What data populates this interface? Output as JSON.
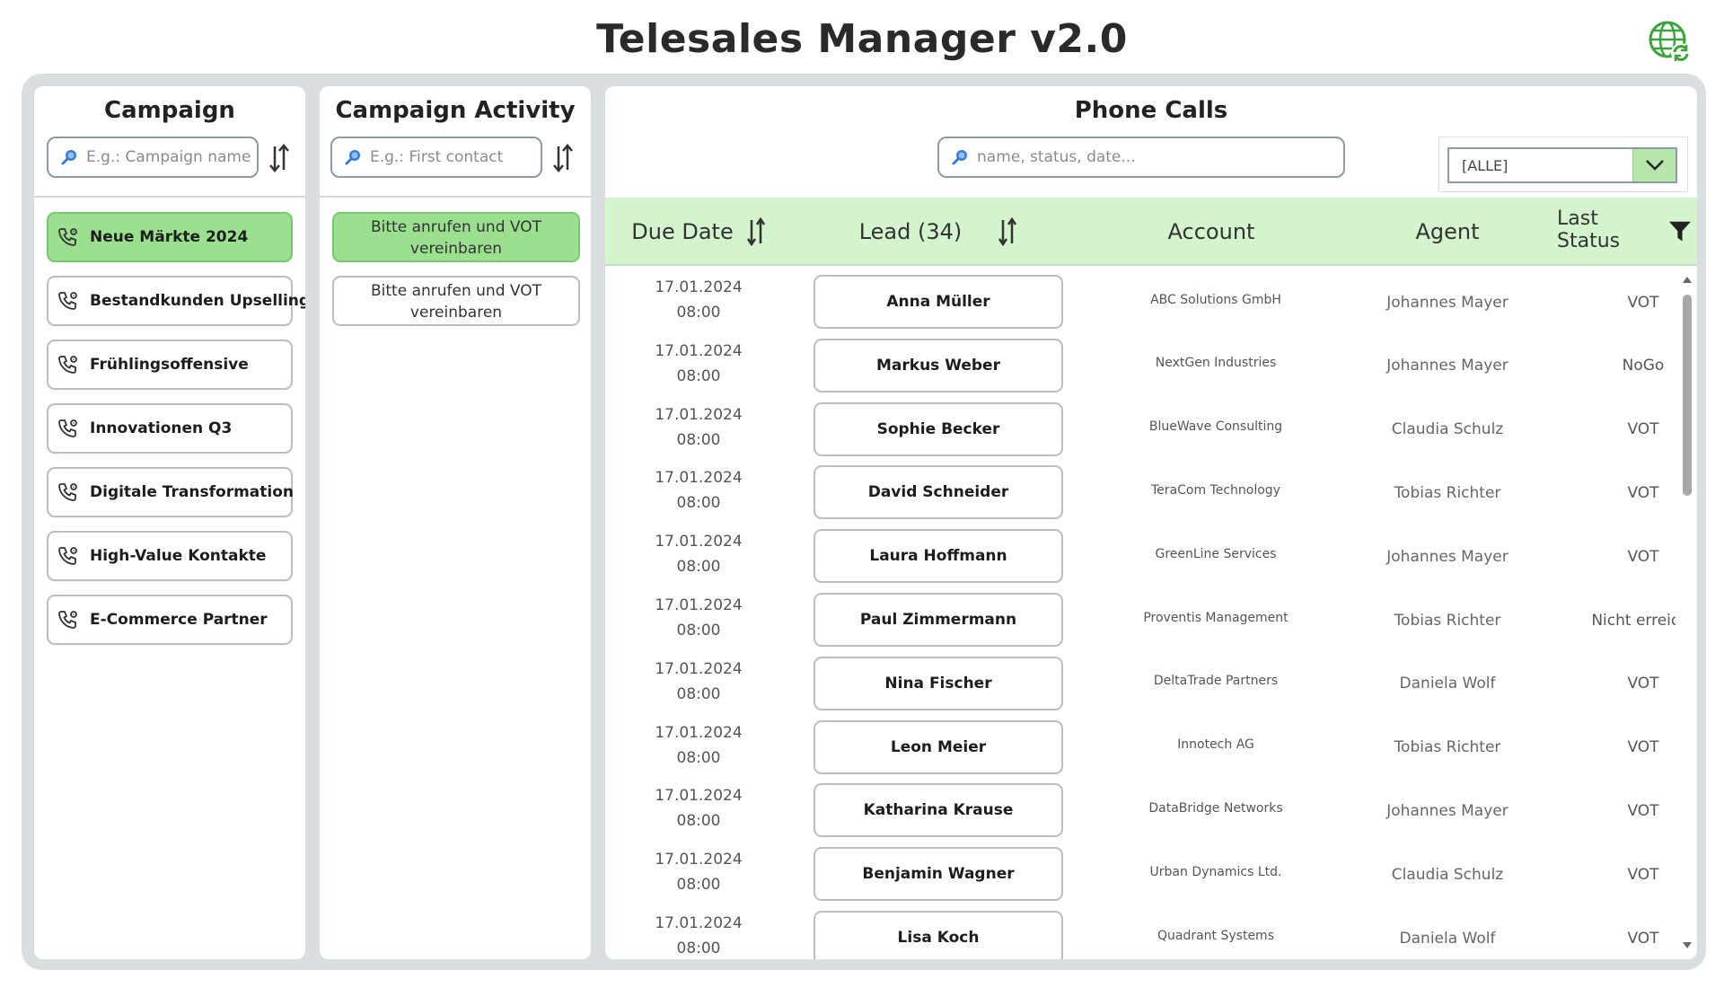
{
  "app": {
    "title": "Telesales Manager v2.0"
  },
  "campaign": {
    "title": "Campaign",
    "search_placeholder": "E.g.: Campaign name",
    "items": [
      {
        "label": "Neue Märkte 2024",
        "active": true
      },
      {
        "label": "Bestandkunden Upselling",
        "active": false
      },
      {
        "label": "Frühlingsoffensive",
        "active": false
      },
      {
        "label": "Innovationen Q3",
        "active": false
      },
      {
        "label": "Digitale Transformation",
        "active": false
      },
      {
        "label": "High-Value Kontakte",
        "active": false
      },
      {
        "label": "E-Commerce Partner",
        "active": false
      }
    ]
  },
  "activity": {
    "title": "Campaign Activity",
    "search_placeholder": "E.g.: First contact",
    "items": [
      {
        "label": "Bitte anrufen und VOT vereinbaren",
        "active": true
      },
      {
        "label": "Bitte anrufen und VOT vereinbaren",
        "active": false
      }
    ]
  },
  "calls": {
    "title": "Phone Calls",
    "search_placeholder": "name, status, date...",
    "filter_value": "[ALLE]",
    "columns": {
      "due_date": "Due Date",
      "lead": "Lead (34)",
      "account": "Account",
      "agent": "Agent",
      "last_status": "Last Status"
    },
    "rows": [
      {
        "date": "17.01.2024",
        "time": "08:00",
        "lead": "Anna Müller",
        "account": "ABC Solutions GmbH",
        "agent": "Johannes Mayer",
        "status": "VOT"
      },
      {
        "date": "17.01.2024",
        "time": "08:00",
        "lead": "Markus Weber",
        "account": "NextGen Industries",
        "agent": "Johannes Mayer",
        "status": "NoGo"
      },
      {
        "date": "17.01.2024",
        "time": "08:00",
        "lead": "Sophie Becker",
        "account": "BlueWave Consulting",
        "agent": "Claudia Schulz",
        "status": "VOT"
      },
      {
        "date": "17.01.2024",
        "time": "08:00",
        "lead": "David Schneider",
        "account": "TeraCom Technology",
        "agent": "Tobias Richter",
        "status": "VOT"
      },
      {
        "date": "17.01.2024",
        "time": "08:00",
        "lead": "Laura Hoffmann",
        "account": "GreenLine Services",
        "agent": "Johannes Mayer",
        "status": "VOT"
      },
      {
        "date": "17.01.2024",
        "time": "08:00",
        "lead": "Paul Zimmermann",
        "account": "Proventis Management",
        "agent": "Tobias Richter",
        "status": "Nicht erreicht"
      },
      {
        "date": "17.01.2024",
        "time": "08:00",
        "lead": "Nina Fischer",
        "account": "DeltaTrade Partners",
        "agent": "Daniela Wolf",
        "status": "VOT"
      },
      {
        "date": "17.01.2024",
        "time": "08:00",
        "lead": "Leon Meier",
        "account": "Innotech AG",
        "agent": "Tobias Richter",
        "status": "VOT"
      },
      {
        "date": "17.01.2024",
        "time": "08:00",
        "lead": "Katharina Krause",
        "account": "DataBridge Networks",
        "agent": "Johannes Mayer",
        "status": "VOT"
      },
      {
        "date": "17.01.2024",
        "time": "08:00",
        "lead": "Benjamin Wagner",
        "account": "Urban Dynamics Ltd.",
        "agent": "Claudia Schulz",
        "status": "VOT"
      },
      {
        "date": "17.01.2024",
        "time": "08:00",
        "lead": "Lisa Koch",
        "account": "Quadrant Systems",
        "agent": "Daniela Wolf",
        "status": "VOT"
      }
    ]
  },
  "colors": {
    "accent_green": "#9be08f",
    "header_green": "#d3f4cc",
    "frame": "#d9dee1",
    "globe_green": "#3aa43a"
  }
}
